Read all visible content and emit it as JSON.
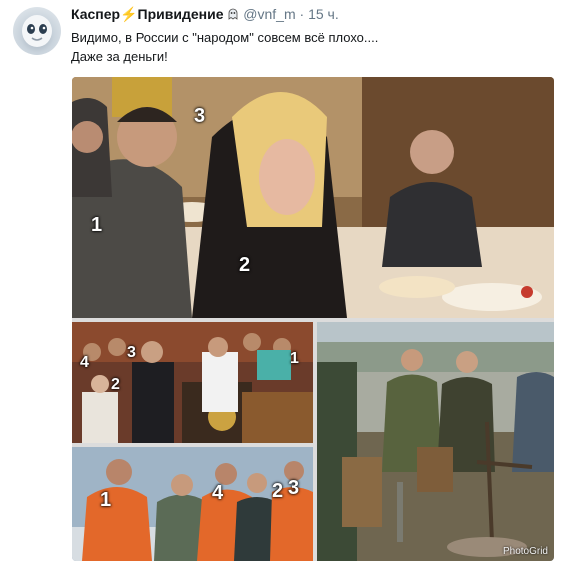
{
  "tweet": {
    "author_name": "Каспер",
    "author_name_suffix": "Привидение",
    "bolt_glyph": "⚡",
    "handle": "@vnf_m",
    "separator": "·",
    "time": "15 ч.",
    "text_line1": "Видимо, в России с \"народом\" совсем всё плохо....",
    "text_line2": "Даже за деньги!"
  },
  "media": {
    "watermark": "PhotoGrid",
    "photo_main": {
      "labels": [
        "1",
        "2",
        "3"
      ]
    },
    "photo_church": {
      "labels": [
        "4",
        "3",
        "2",
        "1"
      ]
    },
    "photo_workers": {
      "labels": [
        "1",
        "4",
        "2",
        "3"
      ]
    }
  }
}
